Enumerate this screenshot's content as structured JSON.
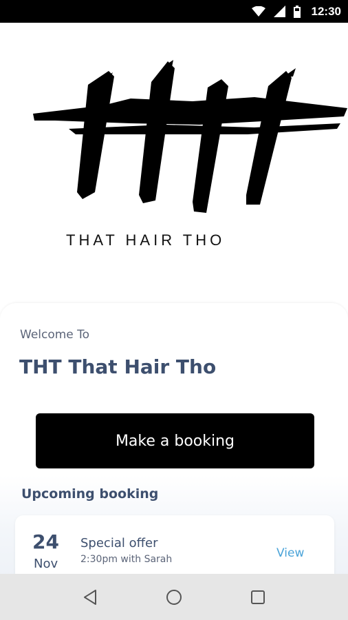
{
  "status_bar": {
    "time": "12:30",
    "icons": [
      "wifi-icon",
      "cell-signal-icon",
      "battery-icon"
    ]
  },
  "logo": {
    "letters": "THT",
    "tagline": "THAT HAIR THO"
  },
  "home": {
    "welcome_label": "Welcome To",
    "salon_name": "THT That Hair Tho",
    "booking_button_label": "Make a booking",
    "upcoming_title": "Upcoming booking"
  },
  "upcoming_booking": {
    "day": "24",
    "month": "Nov",
    "title": "Special offer",
    "detail": "2:30pm with Sarah",
    "view_label": "View"
  },
  "nav_bar": {
    "buttons": [
      "back-icon",
      "home-icon",
      "recents-icon"
    ]
  },
  "colors": {
    "accent_dark": "#3d4f6e",
    "link": "#4aa3d8",
    "button_bg": "#000000"
  }
}
